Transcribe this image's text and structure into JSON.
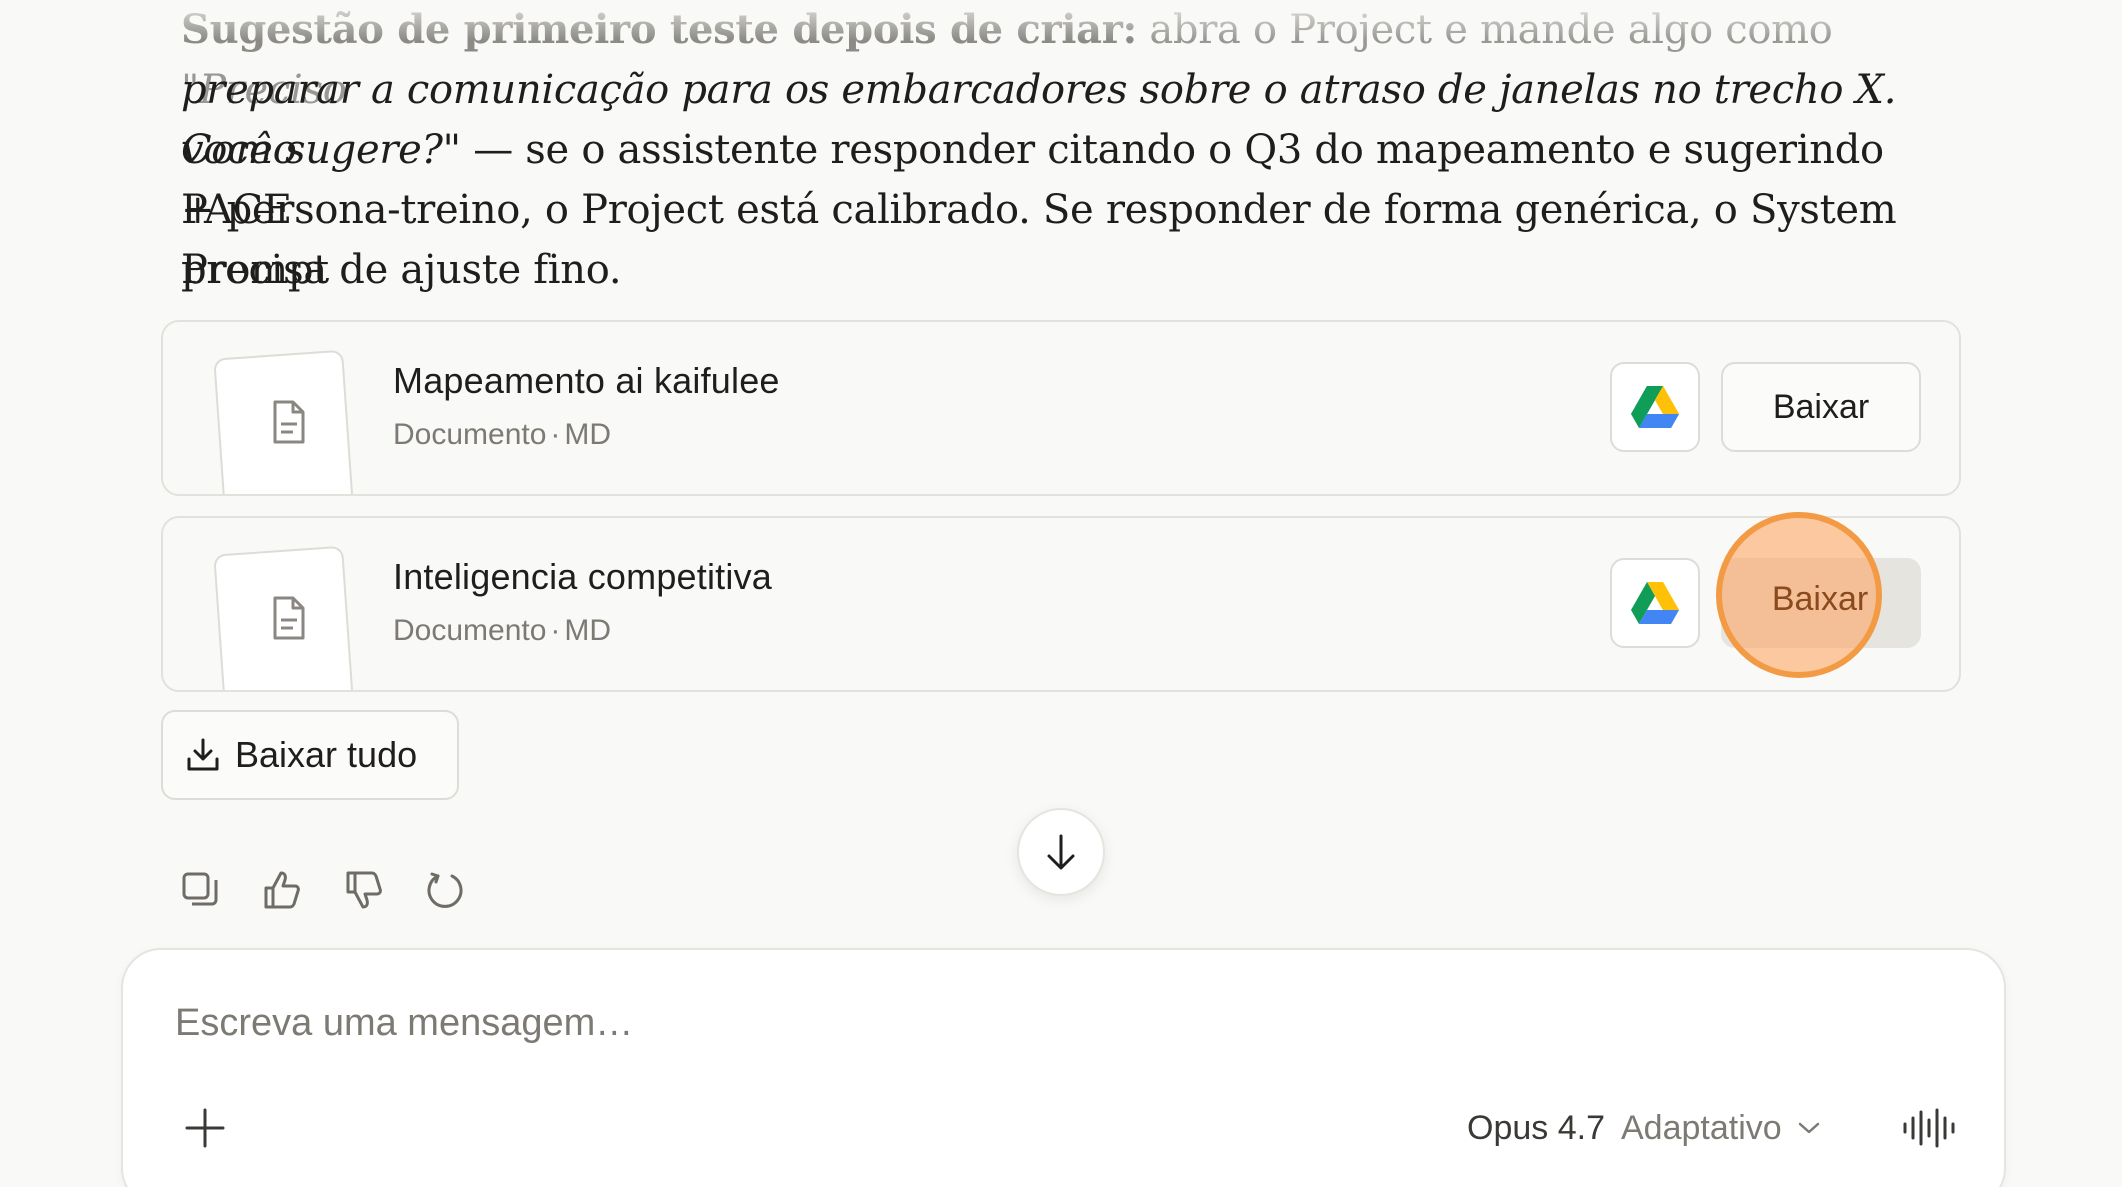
{
  "message": {
    "line1_bold": "Sugestão de primeiro teste depois de criar:",
    "line1_rest": " abra o Project e mande algo como ",
    "line1_italic": "\"Preciso",
    "line2_italic": "preparar a comunicação para os embarcadores sobre o atraso de janelas no trecho X. Como",
    "line3_italic": "você sugere?\"",
    "line3_rest": " — se o assistente responder citando o Q3 do mapeamento e sugerindo PACE",
    "line4": "+ persona-treino, o Project está calibrado. Se responder de forma genérica, o System Prompt",
    "line5": "precisa de ajuste fino."
  },
  "files": [
    {
      "name": "Mapeamento ai kaifulee",
      "type": "Documento",
      "sep": "·",
      "format": "MD",
      "download_label": "Baixar"
    },
    {
      "name": "Inteligencia competitiva",
      "type": "Documento",
      "sep": "·",
      "format": "MD",
      "download_label": "Baixar"
    }
  ],
  "download_all_label": "Baixar tudo",
  "composer": {
    "placeholder": "Escreva uma mensagem…",
    "model_name": "Opus 4.7",
    "model_mode": "Adaptativo"
  },
  "icons": {
    "file": "document-icon",
    "drive": "google-drive-icon",
    "download": "download-icon",
    "copy": "copy-icon",
    "thumbs_up": "thumbs-up-icon",
    "thumbs_down": "thumbs-down-icon",
    "retry": "retry-icon",
    "scroll": "arrow-down-icon",
    "plus": "plus-icon",
    "chevron": "chevron-down-icon",
    "voice": "voice-waveform-icon"
  },
  "colors": {
    "background": "#f9f9f7",
    "highlight": "#f39a45",
    "text": "#1f1e1d",
    "muted": "#7d7a74"
  }
}
